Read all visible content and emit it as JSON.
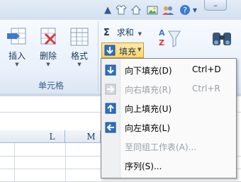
{
  "title_icons": [
    "caret-up-icon",
    "shirt-icon",
    "home-icon",
    "picture-icon",
    "users-icon",
    "help-icon",
    "chevron-down-icon"
  ],
  "window_controls": {
    "min": "–"
  },
  "ribbon": {
    "cells_group": {
      "label": "单元格",
      "insert": "插入",
      "delete": "删除",
      "format": "格式"
    },
    "editing": {
      "autosum_symbol": "Σ",
      "autosum_label": "求和",
      "fill_label": "填充",
      "sort_filter_partial": "排序和筛选",
      "find_select_partial": "查找和选择"
    }
  },
  "fill_menu": {
    "items": [
      {
        "label": "向下填充(D)",
        "shortcut": "Ctrl+D",
        "enabled": true,
        "icon": "fill-down-icon"
      },
      {
        "label": "向右填充(R)",
        "shortcut": "Ctrl+R",
        "enabled": false,
        "icon": "fill-right-icon"
      },
      {
        "label": "向上填充(U)",
        "shortcut": "",
        "enabled": true,
        "icon": "fill-up-icon"
      },
      {
        "label": "向左填充(L)",
        "shortcut": "",
        "enabled": true,
        "icon": "fill-left-icon"
      },
      {
        "label": "至同组工作表(A)...",
        "shortcut": "",
        "enabled": false,
        "icon": ""
      },
      {
        "label": "序列(S)...",
        "shortcut": "",
        "enabled": true,
        "icon": ""
      }
    ]
  },
  "sheet": {
    "columns": [
      "L",
      "M"
    ]
  },
  "colors": {
    "menu_bg": "#fafafa",
    "fill_button_hover": "#ffd46a",
    "ribbon_text": "#1e395b",
    "icon_blue": "#2f6fc0"
  }
}
